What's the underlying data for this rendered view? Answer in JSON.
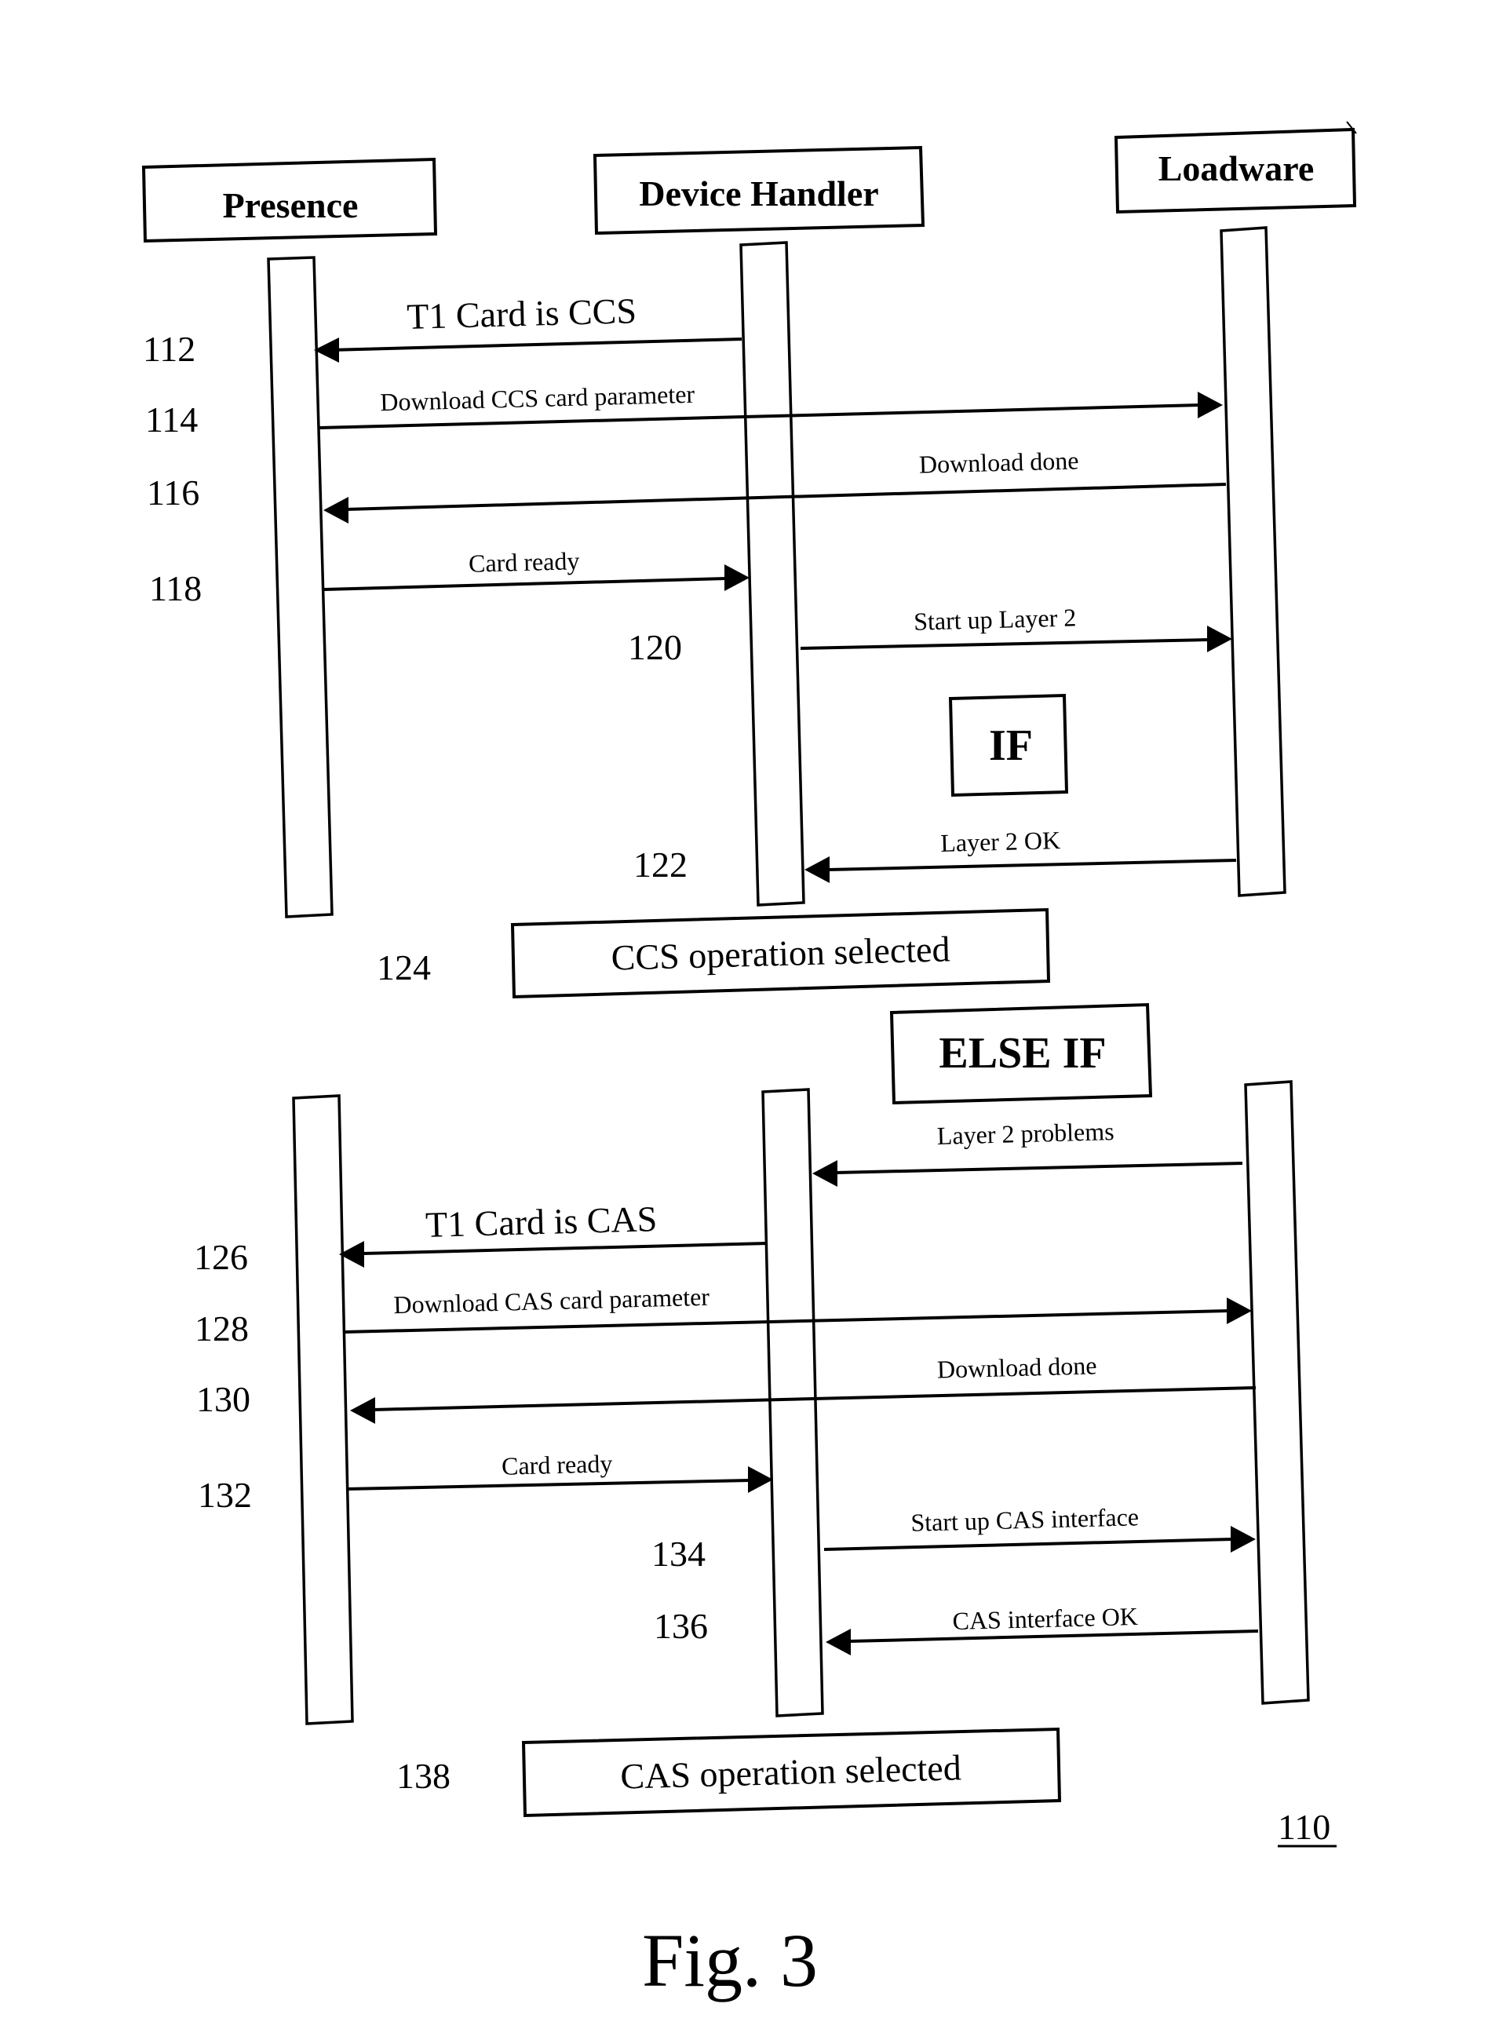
{
  "figure": {
    "caption": "Fig. 3",
    "reference_number": "110"
  },
  "actors": [
    {
      "name": "Presence"
    },
    {
      "name": "Device Handler"
    },
    {
      "name": "Loadware"
    }
  ],
  "conditions": {
    "if_label": "IF",
    "else_if_label": "ELSE IF"
  },
  "section_ccs": {
    "messages": [
      {
        "ref": "112",
        "label": "T1 Card is CCS",
        "from": "Device Handler",
        "to": "Presence"
      },
      {
        "ref": "114",
        "label": "Download CCS card parameter",
        "from": "Presence",
        "to": "Loadware"
      },
      {
        "ref": "116",
        "label": "Download done",
        "from": "Loadware",
        "to": "Presence"
      },
      {
        "ref": "118",
        "label": "Card ready",
        "from": "Presence",
        "to": "Device Handler"
      },
      {
        "ref": "120",
        "label": "Start up Layer 2",
        "from": "Device Handler",
        "to": "Loadware"
      },
      {
        "ref": "122",
        "label": "Layer 2 OK",
        "from": "Loadware",
        "to": "Device Handler"
      }
    ],
    "result": {
      "ref": "124",
      "label": "CCS operation selected"
    }
  },
  "section_cas": {
    "trigger": {
      "label": "Layer 2 problems",
      "from": "Loadware",
      "to": "Device Handler"
    },
    "messages": [
      {
        "ref": "126",
        "label": "T1 Card is CAS",
        "from": "Device Handler",
        "to": "Presence"
      },
      {
        "ref": "128",
        "label": "Download CAS card parameter",
        "from": "Presence",
        "to": "Loadware"
      },
      {
        "ref": "130",
        "label": "Download done",
        "from": "Loadware",
        "to": "Presence"
      },
      {
        "ref": "132",
        "label": "Card ready",
        "from": "Presence",
        "to": "Device Handler"
      },
      {
        "ref": "134",
        "label": "Start up CAS interface",
        "from": "Device Handler",
        "to": "Loadware"
      },
      {
        "ref": "136",
        "label": "CAS interface OK",
        "from": "Loadware",
        "to": "Device Handler"
      }
    ],
    "result": {
      "ref": "138",
      "label": "CAS operation selected"
    }
  }
}
